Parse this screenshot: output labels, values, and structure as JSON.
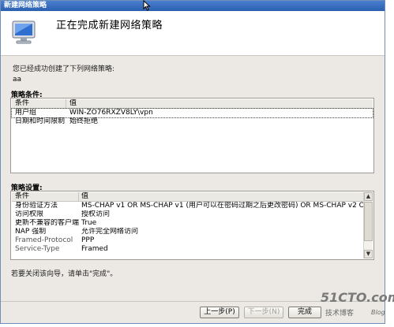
{
  "window": {
    "title": "新建网络策略"
  },
  "header": {
    "title": "正在完成新建网络策略",
    "icon": "computer-monitor-icon"
  },
  "intro_text": "您已经成功创建了下列网络策略:",
  "policy_name": "aa",
  "conditions": {
    "label": "策略条件:",
    "columns": [
      "条件",
      "值"
    ],
    "rows": [
      {
        "name": "用户组",
        "value": "WIN-ZO76RXZV8LY\\vpn"
      },
      {
        "name": "日期和时间限制",
        "value": "始终拒绝"
      }
    ]
  },
  "settings": {
    "label": "策略设置:",
    "columns": [
      "条件",
      "值"
    ],
    "rows": [
      {
        "name": "身份验证方法",
        "value": "MS-CHAP v1 OR MS-CHAP v1 (用户可以在密码过期之后更改密码) OR MS-CHAP v2 OR MS-CHAP ..."
      },
      {
        "name": "访问权限",
        "value": "授权访问"
      },
      {
        "name": "更新不兼容的客户端",
        "value": "True"
      },
      {
        "name": "NAP 强制",
        "value": "允许完全网络访问"
      },
      {
        "name": "Framed-Protocol",
        "value": "PPP"
      },
      {
        "name": "Service-Type",
        "value": "Framed"
      }
    ]
  },
  "hint": "若要关闭该向导，请单击\"完成\"。",
  "buttons": {
    "back": "上一步(P)",
    "next": "下一步(N)",
    "finish": "完成"
  },
  "watermark": {
    "site": "51CTO.com",
    "sub": "技术博客",
    "blog": "Blog"
  }
}
